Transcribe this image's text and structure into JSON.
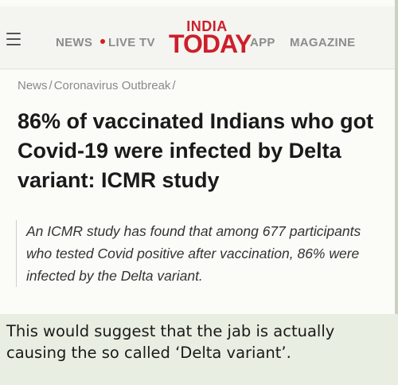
{
  "nav": {
    "links": [
      "NEWS",
      "LIVE TV",
      "APP",
      "MAGAZINE"
    ],
    "brand_top": "INDIA",
    "brand_bottom": "TODAY",
    "brand_color": "#cc1f2b",
    "live_dot_color": "#d31e1e"
  },
  "breadcrumb": {
    "items": [
      "News",
      "Coronavirus Outbreak"
    ],
    "separator": "/"
  },
  "article": {
    "headline": "86% of vaccinated Indians who got Covid-19 were infected by Delta variant: ICMR study",
    "summary": "An ICMR study has found that among 677 participants who tested Covid positive after vaccination, 86% were infected by the Delta variant."
  },
  "caption": {
    "text": "This would suggest that the jab is actually causing the so called ‘Delta variant’."
  },
  "icons": {
    "menu": "hamburger-menu-icon",
    "live": "live-dot-icon"
  }
}
